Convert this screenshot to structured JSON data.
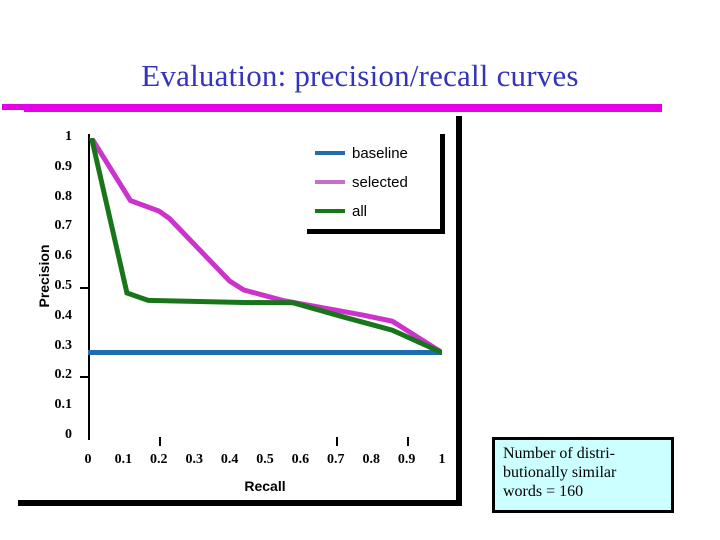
{
  "slide": {
    "title": "Evaluation: precision/recall curves",
    "title_color": "#3333bb",
    "rule_color": "#e600e6"
  },
  "annotation": {
    "name": "distributional-words-note",
    "text": "Number of distri-\nbutionally similar\nwords = 160",
    "background": "#ccffff",
    "border_color": "#000000"
  },
  "legend": {
    "position": "inside-top-right",
    "entries": [
      {
        "label": "baseline",
        "color": "#1f6cb0"
      },
      {
        "label": "selected",
        "color": "#c86ec8"
      },
      {
        "label": "all",
        "color": "#197519"
      }
    ]
  },
  "chart_data": {
    "type": "line",
    "title": "",
    "xlabel": "Recall",
    "ylabel": "Precision",
    "xlim": [
      0,
      1
    ],
    "ylim": [
      0,
      1
    ],
    "grid": false,
    "legend_position": "inside-top-right",
    "xticks": [
      0,
      0.1,
      0.2,
      0.3,
      0.4,
      0.5,
      0.6,
      0.7,
      0.8,
      0.9,
      1
    ],
    "xtick_labels": [
      "0",
      "0.1",
      "0.2",
      "0.3",
      "0.4",
      "0.5",
      "0.6",
      "0.7",
      "0.8",
      "0.9",
      "1"
    ],
    "yticks": [
      0,
      0.1,
      0.2,
      0.3,
      0.4,
      0.5,
      0.6,
      0.7,
      0.8,
      0.9,
      1
    ],
    "ytick_labels": [
      "0",
      "0.1",
      "0.2",
      "0.3",
      "0.4",
      "0.5",
      "0.6",
      "0.7",
      "0.8",
      "0.9",
      "1"
    ],
    "series": [
      {
        "name": "baseline",
        "color": "#1f6cb0",
        "width": 5,
        "points": [
          [
            0.0,
            0.28
          ],
          [
            1.0,
            0.28
          ]
        ]
      },
      {
        "name": "selected",
        "color": "#cc33cc",
        "width": 5,
        "points": [
          [
            0.01,
            1.0
          ],
          [
            0.12,
            0.79
          ],
          [
            0.2,
            0.755
          ],
          [
            0.23,
            0.73
          ],
          [
            0.4,
            0.52
          ],
          [
            0.44,
            0.49
          ],
          [
            0.55,
            0.455
          ],
          [
            0.78,
            0.405
          ],
          [
            0.86,
            0.385
          ],
          [
            1.0,
            0.28
          ]
        ]
      },
      {
        "name": "all",
        "color": "#197519",
        "width": 5,
        "points": [
          [
            0.01,
            1.0
          ],
          [
            0.11,
            0.48
          ],
          [
            0.17,
            0.455
          ],
          [
            0.44,
            0.448
          ],
          [
            0.58,
            0.447
          ],
          [
            0.72,
            0.4
          ],
          [
            0.86,
            0.355
          ],
          [
            1.0,
            0.28
          ]
        ]
      }
    ]
  }
}
